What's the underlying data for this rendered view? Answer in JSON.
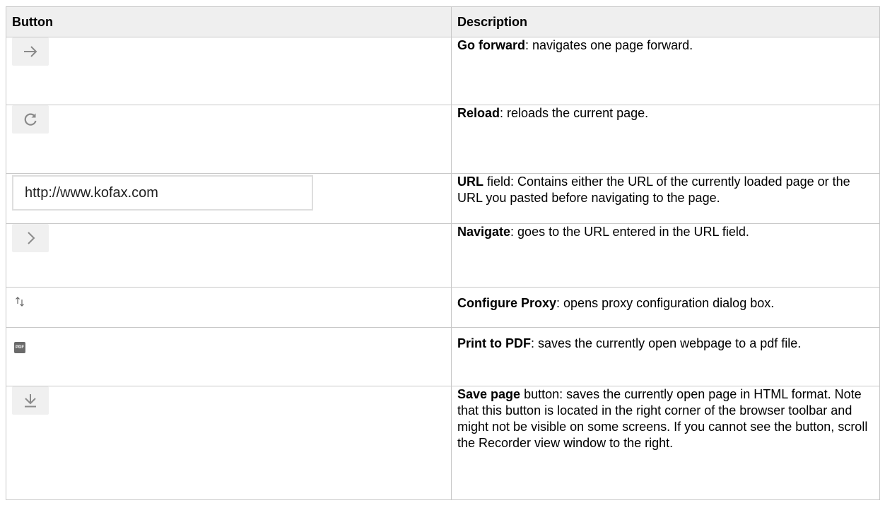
{
  "table": {
    "headers": {
      "button": "Button",
      "description": "Description"
    },
    "rows": [
      {
        "icon": "arrow-right-icon",
        "term": "Go forward",
        "rest": ": navigates one page forward."
      },
      {
        "icon": "reload-icon",
        "term": "Reload",
        "rest": ": reloads the current page."
      },
      {
        "icon": "url-field",
        "url_value": "http://www.kofax.com",
        "term": "URL",
        "rest": " field: Contains either the URL of the currently loaded page or the URL you pasted before navigating to the page."
      },
      {
        "icon": "chevron-right-icon",
        "term": "Navigate",
        "rest": ": goes to the URL entered in the URL field."
      },
      {
        "icon": "proxy-arrows-icon",
        "term": "Configure Proxy",
        "rest": ": opens proxy configuration dialog box."
      },
      {
        "icon": "pdf-icon",
        "pdf_icon_text": "PDF",
        "term": "Print to PDF",
        "rest": ": saves the currently open webpage to a pdf file."
      },
      {
        "icon": "download-icon",
        "term": "Save page",
        "rest": " button: saves the currently open page in HTML format. Note that this button is located in the right corner of the browser toolbar and might not be visible on some screens. If you cannot see the button, scroll the Recorder view window to the right."
      }
    ]
  }
}
